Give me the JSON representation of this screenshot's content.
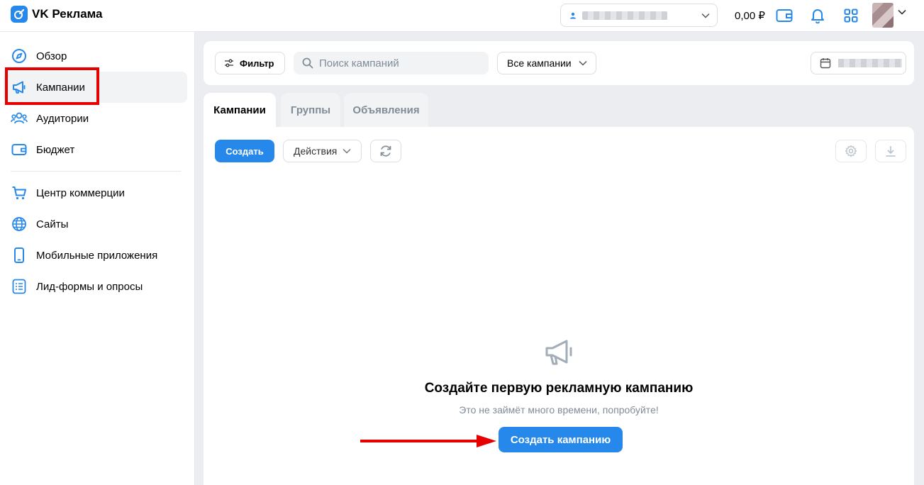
{
  "header": {
    "logo_text": "VK Реклама",
    "balance": "0,00 ₽"
  },
  "sidebar": {
    "items": [
      {
        "label": "Обзор",
        "icon": "compass-icon"
      },
      {
        "label": "Кампании",
        "icon": "megaphone-icon"
      },
      {
        "label": "Аудитории",
        "icon": "users-icon"
      },
      {
        "label": "Бюджет",
        "icon": "wallet-icon"
      },
      {
        "label": "Центр коммерции",
        "icon": "cart-icon"
      },
      {
        "label": "Сайты",
        "icon": "globe-icon"
      },
      {
        "label": "Мобильные приложения",
        "icon": "smartphone-icon"
      },
      {
        "label": "Лид-формы и опросы",
        "icon": "list-icon"
      }
    ],
    "active_index": 1
  },
  "filters": {
    "filter_label": "Фильтр",
    "search_placeholder": "Поиск кампаний",
    "scope_value": "Все кампании"
  },
  "tabs": [
    {
      "label": "Кампании",
      "active": true
    },
    {
      "label": "Группы",
      "active": false
    },
    {
      "label": "Объявления",
      "active": false
    }
  ],
  "toolbar": {
    "create_label": "Создать",
    "actions_label": "Действия"
  },
  "empty_state": {
    "title": "Создайте первую рекламную кампанию",
    "subtitle": "Это не займёт много времени, попробуйте!",
    "button_label": "Создать кампанию"
  },
  "colors": {
    "accent": "#2688eb",
    "annotation_red": "#e60000",
    "background": "#ebedf0"
  }
}
